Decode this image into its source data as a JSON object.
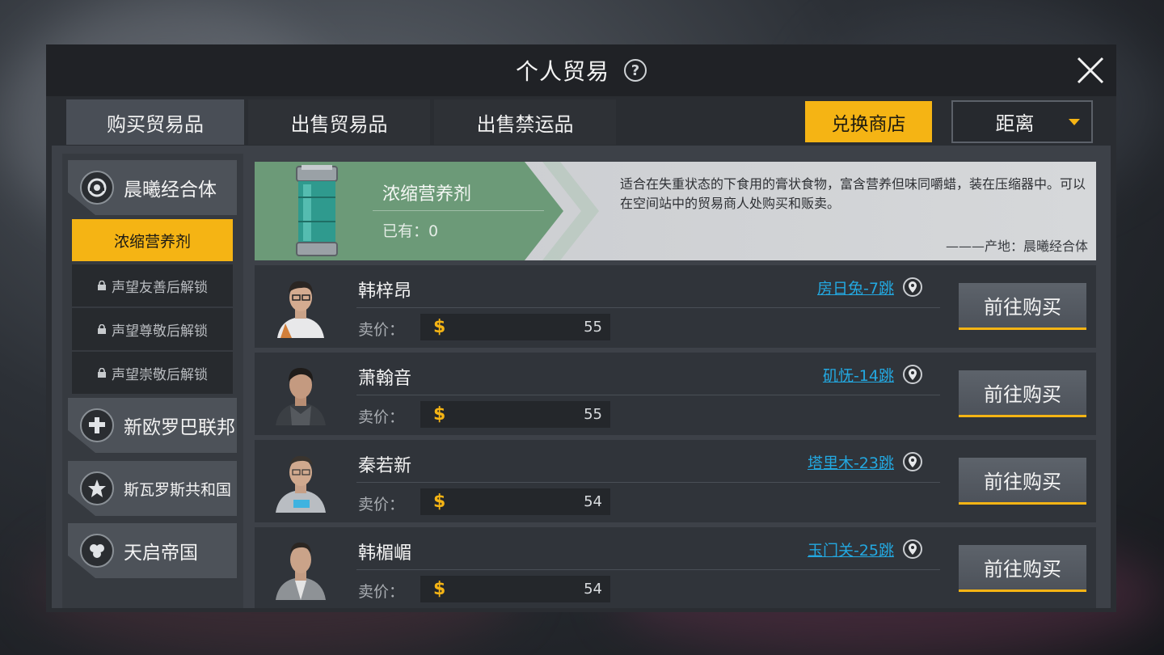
{
  "window": {
    "title": "个人贸易",
    "help_icon": "help-icon",
    "close_icon": "close-icon"
  },
  "tabs": [
    {
      "label": "购买贸易品",
      "active": true
    },
    {
      "label": "出售贸易品",
      "active": false
    },
    {
      "label": "出售禁运品",
      "active": false
    }
  ],
  "toolbar": {
    "exchange_label": "兑换商店",
    "sort_selected": "距离"
  },
  "sidebar": {
    "factions": [
      {
        "name": "晨曦经合体",
        "icon": "dawn-faction-icon",
        "expanded": true
      },
      {
        "name": "新欧罗巴联邦",
        "icon": "cross-faction-icon"
      },
      {
        "name": "斯瓦罗斯共和国",
        "icon": "star-faction-icon"
      },
      {
        "name": "天启帝国",
        "icon": "orb-faction-icon"
      }
    ],
    "sub_items": [
      {
        "label": "浓缩营养剂",
        "state": "active"
      },
      {
        "label": "声望友善后解锁",
        "state": "locked"
      },
      {
        "label": "声望尊敬后解锁",
        "state": "locked"
      },
      {
        "label": "声望崇敬后解锁",
        "state": "locked"
      }
    ]
  },
  "item": {
    "name": "浓缩营养剂",
    "owned": "已有：0",
    "description": "适合在失重状态的下食用的膏状食物，富含营养但味同嚼蜡，装在压缩器中。可以在空间站中的贸易商人处购买和贩卖。",
    "origin": "———产地：晨曦经合体",
    "icon": "nutrient-canister-icon"
  },
  "sellers": {
    "price_label": "卖价：",
    "buy_label": "前往购买",
    "rows": [
      {
        "name": "韩梓昂",
        "location": "房日兔-7跳",
        "price": "55"
      },
      {
        "name": "萧翰音",
        "location": "矶怃-14跳",
        "price": "55"
      },
      {
        "name": "秦若新",
        "location": "塔里木-23跳",
        "price": "54"
      },
      {
        "name": "韩楣嵋",
        "location": "玉门关-25跳",
        "price": "54"
      }
    ]
  },
  "colors": {
    "accent": "#f5b414",
    "link": "#23a8e0",
    "banner_green": "#6c9a78"
  }
}
